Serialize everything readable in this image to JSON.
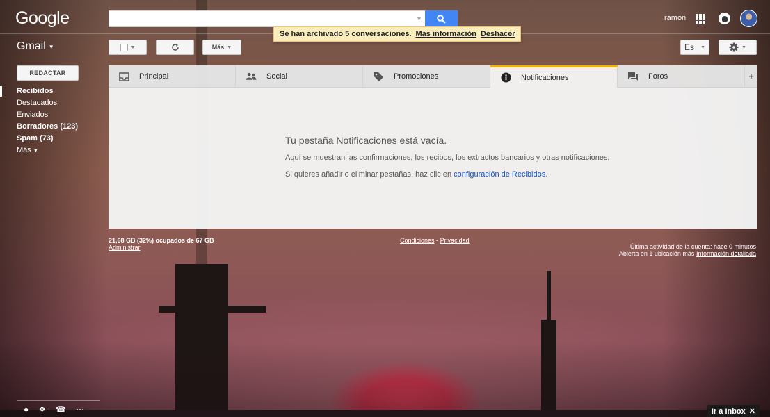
{
  "header": {
    "logo": "Google",
    "search": {
      "value": "",
      "placeholder": ""
    },
    "user_name": "ramon"
  },
  "toast": {
    "message": "Se han archivado 5 conversaciones.",
    "more_info": "Más información",
    "undo": "Deshacer"
  },
  "toolbar": {
    "app_label": "Gmail",
    "more_label": "Más",
    "language_label": "Es"
  },
  "sidebar": {
    "compose_label": "REDACTAR",
    "items": [
      {
        "label": "Recibidos",
        "bold": true,
        "active": true
      },
      {
        "label": "Destacados",
        "bold": false
      },
      {
        "label": "Enviados",
        "bold": false
      },
      {
        "label": "Borradores (123)",
        "bold": true
      },
      {
        "label": "Spam (73)",
        "bold": true
      },
      {
        "label": "Más",
        "bold": false
      }
    ]
  },
  "tabs": [
    {
      "label": "Principal",
      "icon": "inbox-icon"
    },
    {
      "label": "Social",
      "icon": "people-icon"
    },
    {
      "label": "Promociones",
      "icon": "tag-icon"
    },
    {
      "label": "Notificaciones",
      "icon": "info-icon",
      "active": true
    },
    {
      "label": "Foros",
      "icon": "forum-icon"
    }
  ],
  "tab_add": "+",
  "empty_state": {
    "title": "Tu pestaña Notificaciones está vacía.",
    "description": "Aquí se muestran las confirmaciones, los recibos, los extractos bancarios y otras notificaciones.",
    "hint_prefix": "Si quieres añadir o eliminar pestañas, haz clic en",
    "hint_link": "configuración de Recibidos",
    "hint_suffix": "."
  },
  "footer": {
    "storage": "21,68 GB (32%) ocupados de 67 GB",
    "manage": "Administrar",
    "terms": "Condiciones",
    "separator": "-",
    "privacy": "Privacidad",
    "activity": "Última actividad de la cuenta: hace 0 minutos",
    "open_location": "Abierta en 1 ubicación más",
    "details": "Información detallada"
  },
  "inbox_link": "Ir a Inbox",
  "colors": {
    "accent_blue": "#4285f4",
    "active_tab": "#f4b400",
    "toast_bg": "#f9edbe",
    "link": "#1155cc"
  }
}
